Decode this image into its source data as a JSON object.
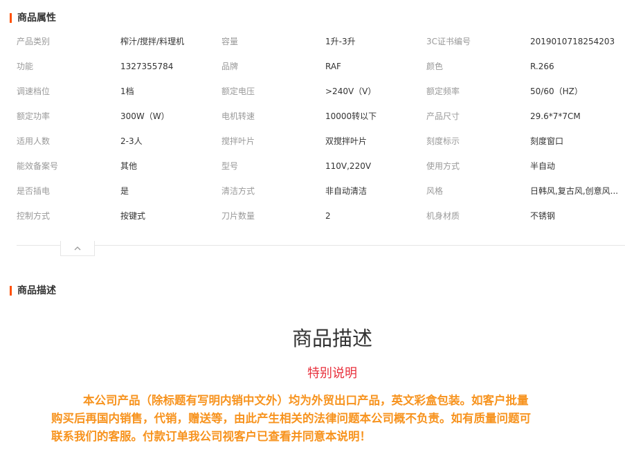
{
  "attributes_section": {
    "title": "商品属性"
  },
  "attributes": [
    [
      [
        "产品类别",
        "榨汁/搅拌/料理机"
      ],
      [
        "容量",
        "1升-3升"
      ],
      [
        "3C证书编号",
        "2019010718254203"
      ]
    ],
    [
      [
        "功能",
        "1327355784"
      ],
      [
        "品牌",
        "RAF"
      ],
      [
        "颜色",
        "R.266"
      ]
    ],
    [
      [
        "调速档位",
        "1档"
      ],
      [
        "额定电压",
        ">240V（V）"
      ],
      [
        "额定频率",
        "50/60（HZ）"
      ]
    ],
    [
      [
        "额定功率",
        "300W（W）"
      ],
      [
        "电机转速",
        "10000转以下"
      ],
      [
        "产品尺寸",
        "29.6*7*7CM"
      ]
    ],
    [
      [
        "适用人数",
        "2-3人"
      ],
      [
        "搅拌叶片",
        "双搅拌叶片"
      ],
      [
        "刻度标示",
        "刻度窗口"
      ]
    ],
    [
      [
        "能效备案号",
        "其他"
      ],
      [
        "型号",
        "110V,220V"
      ],
      [
        "使用方式",
        "半自动"
      ]
    ],
    [
      [
        "是否插电",
        "是"
      ],
      [
        "清洁方式",
        "非自动清洁"
      ],
      [
        "风格",
        "日韩风,复古风,创意风..."
      ]
    ],
    [
      [
        "控制方式",
        "按键式"
      ],
      [
        "刀片数量",
        "2"
      ],
      [
        "机身材质",
        "不锈钢"
      ]
    ]
  ],
  "collapse_icon": "chevron-up-icon",
  "description_section": {
    "title": "商品描述"
  },
  "description": {
    "heading": "商品描述",
    "subheading": "特别说明",
    "lines": [
      "本公司产品（除标题有写明内销中文外）均为外贸出口产品，英文彩盒包装。如客户批量",
      "购买后再国内销售，代销，赠送等，由此产生相关的法律问题本公司概不负责。如有质量问题可",
      "联系我们的客服。付款订单我公司视客户已查看并同意本说明！"
    ]
  },
  "colors": {
    "accent": "#ff5000",
    "notice_red": "#e8303c",
    "notice_orange": "#f7931e"
  }
}
